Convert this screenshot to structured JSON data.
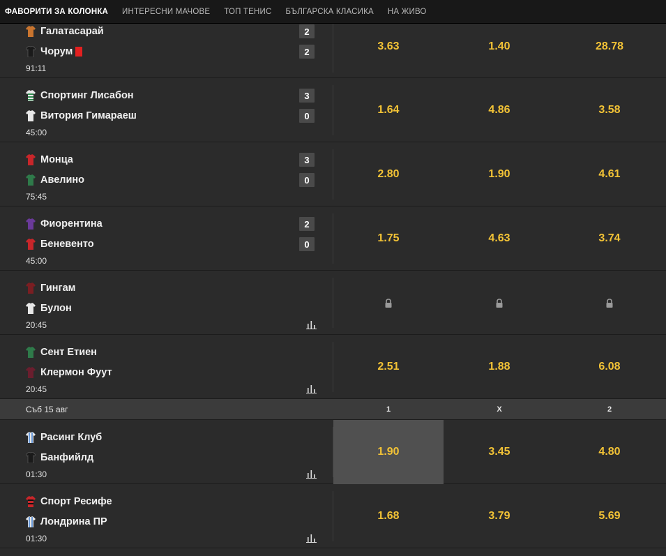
{
  "tabs": [
    {
      "label": "ФАВОРИТИ ЗА КОЛОНКА",
      "active": true
    },
    {
      "label": "ИНТЕРЕСНИ МАЧОВЕ",
      "active": false
    },
    {
      "label": "ТОП ТЕНИС",
      "active": false
    },
    {
      "label": "БЪЛГАРСКА КЛАСИКА",
      "active": false
    },
    {
      "label": "НА ЖИВО",
      "active": false
    }
  ],
  "colors": {
    "odds": "#f3c336",
    "background": "#2b2b2b",
    "tab_bar": "#181818",
    "red_card": "#e32020"
  },
  "matches": [
    {
      "home": "Галатасарай",
      "away": "Чорум",
      "home_score": "2",
      "away_score": "2",
      "time": "91:11",
      "away_red_card": true,
      "odds": [
        "3.63",
        "1.40",
        "28.78"
      ],
      "locked": false,
      "stats_icon": false
    },
    {
      "home": "Спортинг Лисабон",
      "away": "Витория Гимараеш",
      "home_score": "3",
      "away_score": "0",
      "time": "45:00",
      "odds": [
        "1.64",
        "4.86",
        "3.58"
      ],
      "locked": false,
      "stats_icon": false
    },
    {
      "home": "Монца",
      "away": "Авелино",
      "home_score": "3",
      "away_score": "0",
      "time": "75:45",
      "odds": [
        "2.80",
        "1.90",
        "4.61"
      ],
      "locked": false,
      "stats_icon": false
    },
    {
      "home": "Фиорентина",
      "away": "Беневенто",
      "home_score": "2",
      "away_score": "0",
      "time": "45:00",
      "odds": [
        "1.75",
        "4.63",
        "3.74"
      ],
      "locked": false,
      "stats_icon": false
    },
    {
      "home": "Гингам",
      "away": "Булон",
      "home_score": "",
      "away_score": "",
      "time": "20:45",
      "odds": [
        "",
        "",
        ""
      ],
      "locked": true,
      "stats_icon": true
    },
    {
      "home": "Сент Етиен",
      "away": "Клермон Фуут",
      "home_score": "",
      "away_score": "",
      "time": "20:45",
      "odds": [
        "2.51",
        "1.88",
        "6.08"
      ],
      "locked": false,
      "stats_icon": true
    }
  ],
  "date_section": {
    "label": "Съб 15 авг",
    "columns": [
      "1",
      "X",
      "2"
    ],
    "matches": [
      {
        "home": "Расинг Клуб",
        "away": "Банфийлд",
        "time": "01:30",
        "odds": [
          "1.90",
          "3.45",
          "4.80"
        ],
        "selected_index": 0,
        "stats_icon": true
      },
      {
        "home": "Спорт Ресифе",
        "away": "Лондрина ПР",
        "time": "01:30",
        "odds": [
          "1.68",
          "3.79",
          "5.69"
        ],
        "selected_index": -1,
        "stats_icon": true
      }
    ]
  }
}
